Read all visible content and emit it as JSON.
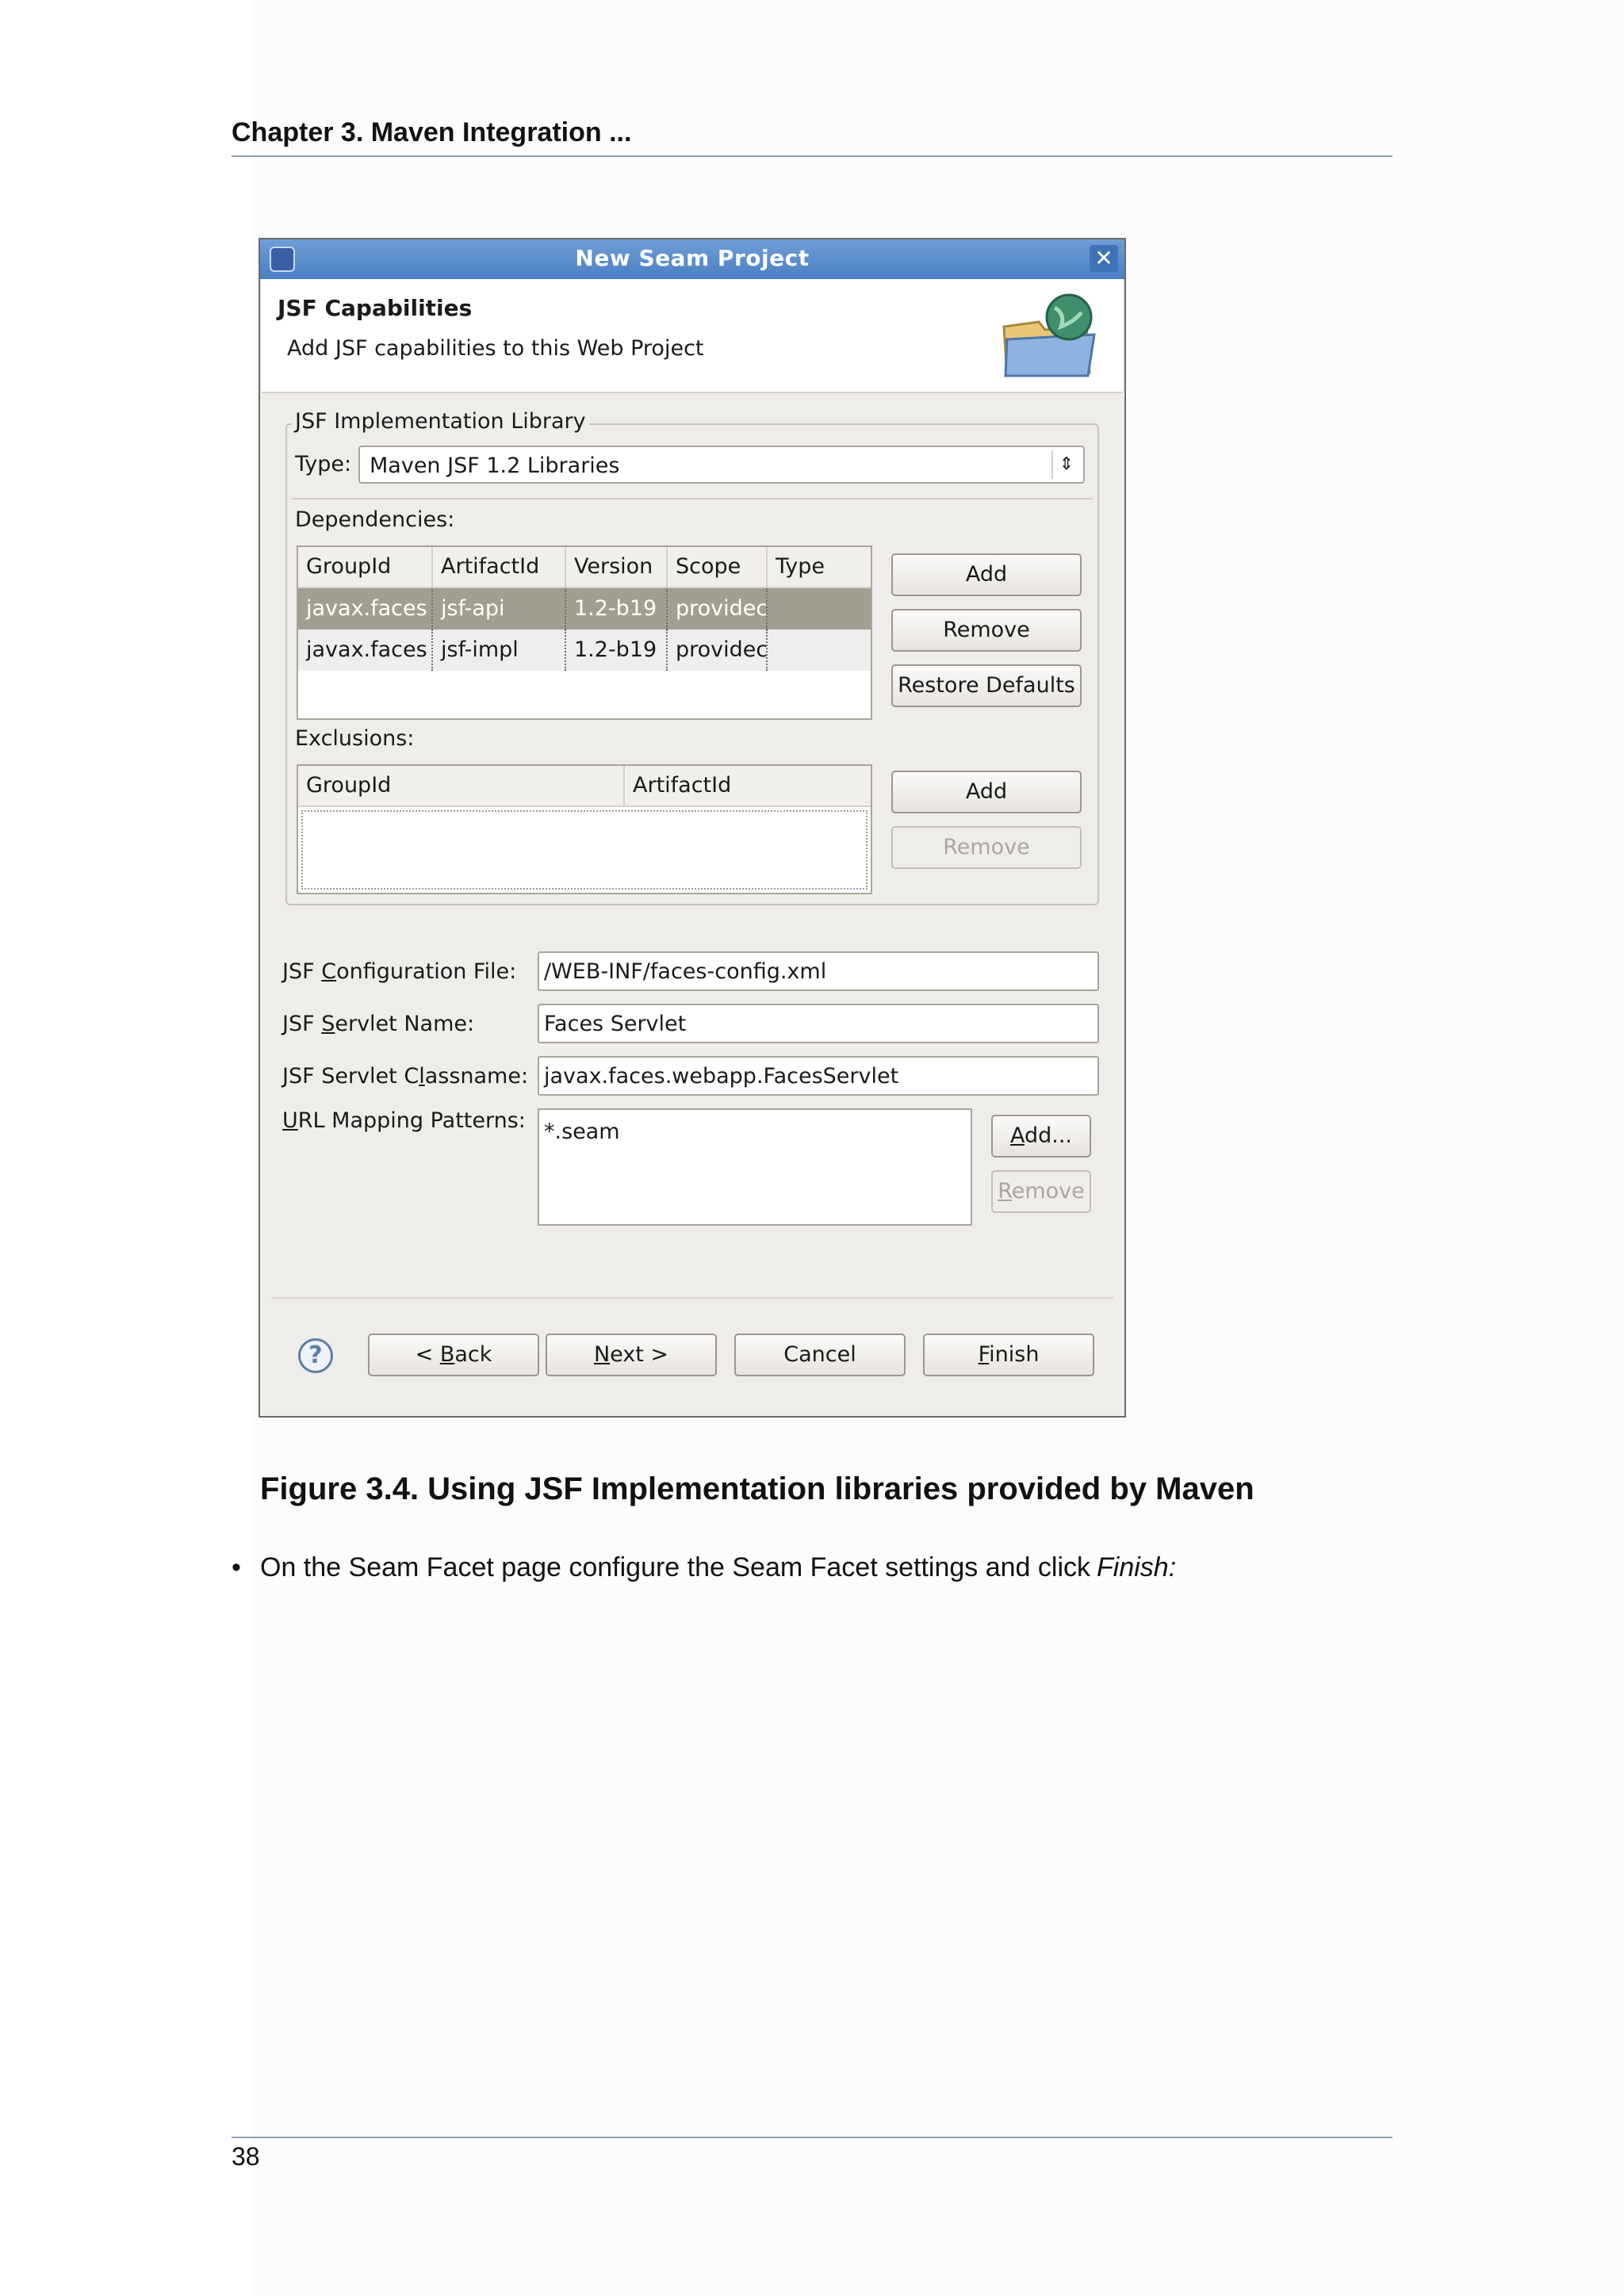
{
  "page": {
    "running_head": "Chapter 3. Maven Integration ...",
    "page_number": "38",
    "figure_caption": "Figure 3.4. Using JSF Implementation libraries provided by Maven",
    "bullet": {
      "marker": "•",
      "text": "On the Seam Facet page configure the Seam Facet settings and click",
      "emphasis": "Finish:"
    }
  },
  "dialog": {
    "title": "New Seam Project",
    "close_symbol": "✕",
    "banner": {
      "title": "JSF Capabilities",
      "description": "Add JSF capabilities to this Web Project"
    },
    "impl_group": {
      "legend": "JSF Implementation Library",
      "type_label": "Type:",
      "type_value": "Maven JSF 1.2 Libraries",
      "dependencies_label": "Dependencies:",
      "dependencies": {
        "columns": [
          "GroupId",
          "ArtifactId",
          "Version",
          "Scope",
          "Type"
        ],
        "rows": [
          [
            "javax.faces",
            "jsf-api",
            "1.2-b19",
            "providec",
            ""
          ],
          [
            "javax.faces",
            "jsf-impl",
            "1.2-b19",
            "providec",
            ""
          ]
        ],
        "buttons": {
          "add": "Add",
          "remove": "Remove",
          "restore": "Restore Defaults"
        }
      },
      "exclusions_label": "Exclusions:",
      "exclusions": {
        "columns": [
          "GroupId",
          "ArtifactId"
        ],
        "buttons": {
          "add": "Add",
          "remove": "Remove"
        }
      }
    },
    "config": {
      "config_file_label": {
        "pre": "JSF ",
        "key": "C",
        "post": "onfiguration File:"
      },
      "config_file_value": "/WEB-INF/faces-config.xml",
      "servlet_name_label": {
        "pre": "JSF ",
        "key": "S",
        "post": "ervlet Name:"
      },
      "servlet_name_value": "Faces Servlet",
      "servlet_class_label": {
        "pre": "JSF Servlet C",
        "key": "l",
        "post": "assname:"
      },
      "servlet_class_value": "javax.faces.webapp.FacesServlet",
      "url_label": {
        "pre": "",
        "key": "U",
        "post": "RL Mapping Patterns:"
      },
      "url_patterns": [
        "*.seam"
      ],
      "url_add": {
        "key": "A",
        "post": "dd..."
      },
      "url_remove": {
        "key": "R",
        "post": "emove"
      }
    },
    "footer": {
      "help_symbol": "?",
      "back": {
        "pre": "< ",
        "key": "B",
        "post": "ack"
      },
      "next": {
        "key": "N",
        "post": "ext >"
      },
      "cancel": "Cancel",
      "finish": {
        "key": "F",
        "post": "inish"
      }
    }
  }
}
